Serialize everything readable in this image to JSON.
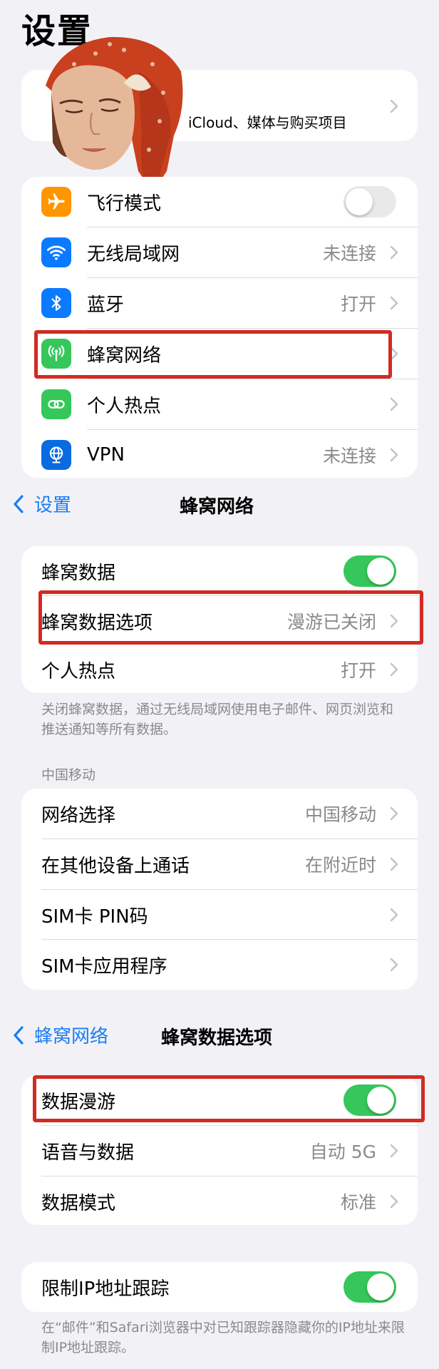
{
  "page_title": "设置",
  "profile": {
    "subtitle": "iCloud、媒体与购买项目"
  },
  "settings_list": [
    {
      "label": "飞行模式",
      "value": "",
      "icon": "airplane-icon",
      "color": "#ff9500"
    },
    {
      "label": "无线局域网",
      "value": "未连接",
      "icon": "wifi-icon",
      "color": "#0a7aff"
    },
    {
      "label": "蓝牙",
      "value": "打开",
      "icon": "bluetooth-icon",
      "color": "#0a7aff"
    },
    {
      "label": "蜂窝网络",
      "value": "",
      "icon": "cellular-antenna-icon",
      "color": "#35c759"
    },
    {
      "label": "个人热点",
      "value": "",
      "icon": "hotspot-link-icon",
      "color": "#35c759"
    },
    {
      "label": "VPN",
      "value": "未连接",
      "icon": "globe-icon",
      "color": "#0a6ae0"
    }
  ],
  "cellular_nav": {
    "back": "设置",
    "title": "蜂窝网络"
  },
  "cellular_list": [
    {
      "label": "蜂窝数据",
      "value": ""
    },
    {
      "label": "蜂窝数据选项",
      "value": "漫游已关闭"
    },
    {
      "label": "个人热点",
      "value": "打开"
    }
  ],
  "cellular_footnote": "关闭蜂窝数据，通过无线局域网使用电子邮件、网页浏览和推送通知等所有数据。",
  "carrier_header": "中国移动",
  "carrier_list": [
    {
      "label": "网络选择",
      "value": "中国移动"
    },
    {
      "label": "在其他设备上通话",
      "value": "在附近时"
    },
    {
      "label": "SIM卡 PIN码",
      "value": ""
    },
    {
      "label": "SIM卡应用程序",
      "value": ""
    }
  ],
  "options_nav": {
    "back": "蜂窝网络",
    "title": "蜂窝数据选项"
  },
  "options_list": [
    {
      "label": "数据漫游",
      "value": ""
    },
    {
      "label": "语音与数据",
      "value": "自动 5G"
    },
    {
      "label": "数据模式",
      "value": "标准"
    }
  ],
  "ip_tracking": {
    "label": "限制IP地址跟踪"
  },
  "ip_footnote": "在“邮件”和Safari浏览器中对已知跟踪器隐藏你的IP地址来限制IP地址跟踪。",
  "toggles": {
    "airplane": false,
    "cellular_data": true,
    "data_roaming": true,
    "limit_ip": true
  },
  "colors": {
    "accent": "#1a7cf5",
    "toggle_on": "#35c759",
    "highlight": "#d22b22"
  }
}
